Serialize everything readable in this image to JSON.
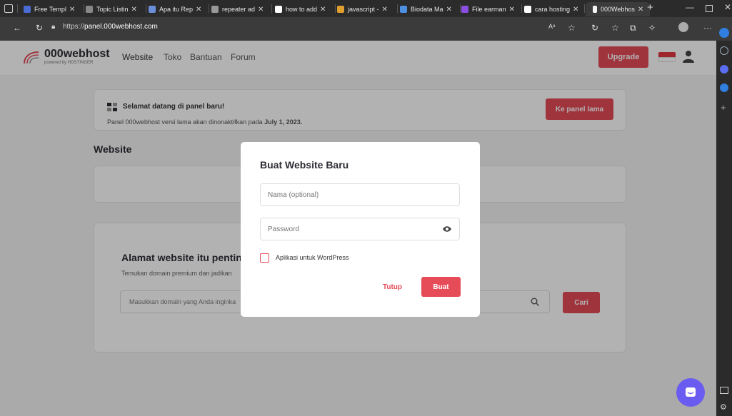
{
  "browser": {
    "tabs": [
      {
        "label": "Free Templ",
        "color": "#4a6cd4"
      },
      {
        "label": "Topic Listin",
        "color": "#888888"
      },
      {
        "label": "Apa itu Rep",
        "color": "#6a8fd8"
      },
      {
        "label": "repeater ad",
        "color": "#999999"
      },
      {
        "label": "how to add",
        "color": "#ffffff"
      },
      {
        "label": "javascript -",
        "color": "#e0a030"
      },
      {
        "label": "Biodata Ma",
        "color": "#4d8fe0"
      },
      {
        "label": "File earman",
        "color": "#8a4ee0"
      },
      {
        "label": "cara hosting",
        "color": "#ffffff"
      }
    ],
    "active_tab": "000Webhos",
    "url_prefix": "https://",
    "url_host": "panel.000webhost.com"
  },
  "header": {
    "logo_name": "000webhost",
    "logo_sub": "powered by HOSTINGER",
    "nav": [
      "Website",
      "Toko",
      "Bantuan",
      "Forum"
    ],
    "upgrade_label": "Upgrade"
  },
  "notice": {
    "title": "Selamat datang di panel baru!",
    "text_prefix": "Panel 000webhost versi lama akan dinonaktifkan pada",
    "date": "July 1, 2023.",
    "button": "Ke panel lama"
  },
  "section_title": "Website",
  "domain_card": {
    "heading": "Alamat website itu pentin",
    "sub": "Temukan domain premium dan jadikan",
    "placeholder": "Masukkan domain yang Anda inginka",
    "search_button": "Cari"
  },
  "modal": {
    "title": "Buat Website Baru",
    "name_placeholder": "Nama (optional)",
    "password_placeholder": "Password",
    "wordpress_label": "Aplikasi untuk WordPress",
    "cancel_label": "Tutup",
    "create_label": "Buat"
  },
  "colors": {
    "accent": "#e64b58"
  }
}
